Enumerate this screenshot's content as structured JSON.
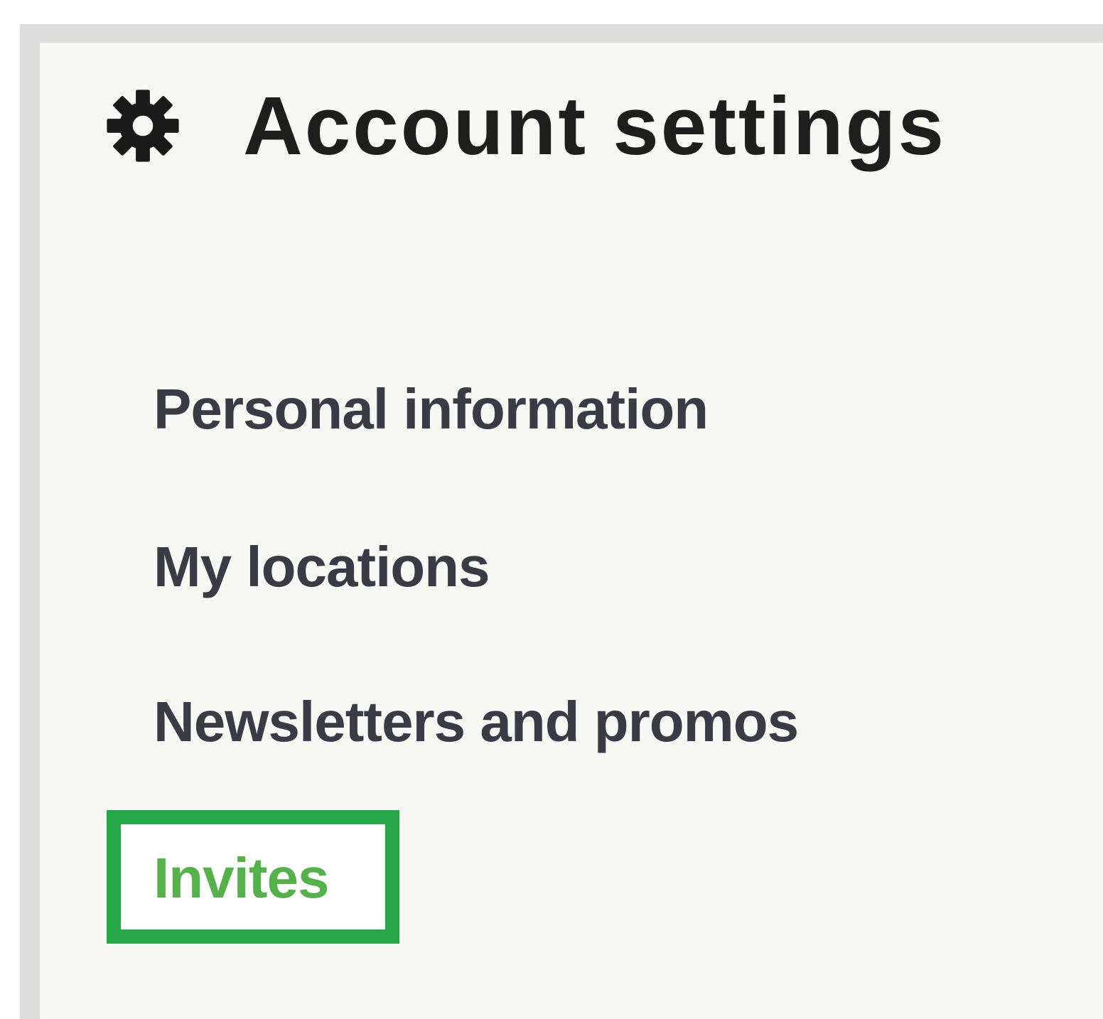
{
  "header": {
    "icon": "gear-icon",
    "title": "Account settings"
  },
  "menu": {
    "items": [
      {
        "label": "Personal information"
      },
      {
        "label": "My locations"
      },
      {
        "label": "Newsletters and promos"
      }
    ],
    "highlighted_item": {
      "label": "Invites",
      "color": "#55b24a",
      "highlight_color": "#25a748"
    }
  }
}
